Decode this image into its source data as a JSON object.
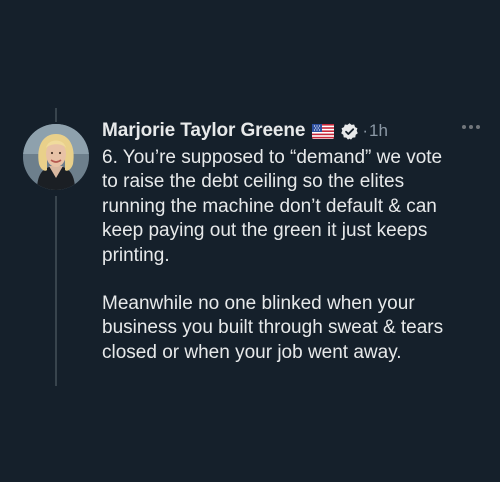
{
  "tweet": {
    "author": {
      "name": "Marjorie Taylor Greene",
      "flag_icon": "us-flag-icon",
      "verified_icon": "verified-badge-icon",
      "verified_color": "#1d9bf0"
    },
    "separator": "·",
    "timestamp": "1h",
    "more_icon": "more-options-icon",
    "paragraphs": [
      "6. You’re supposed to “demand” we vote\nto raise the debt ceiling so the elites\nrunning the machine don’t default & can\nkeep paying out the green it just keeps\nprinting.",
      "Meanwhile no one blinked when your\nbusiness you built through sweat & tears\nclosed or when your job went away."
    ]
  },
  "colors": {
    "background": "#15202b",
    "text_primary": "#e7e9ea",
    "text_secondary": "#8b98a5",
    "thread_line": "#38444d"
  }
}
